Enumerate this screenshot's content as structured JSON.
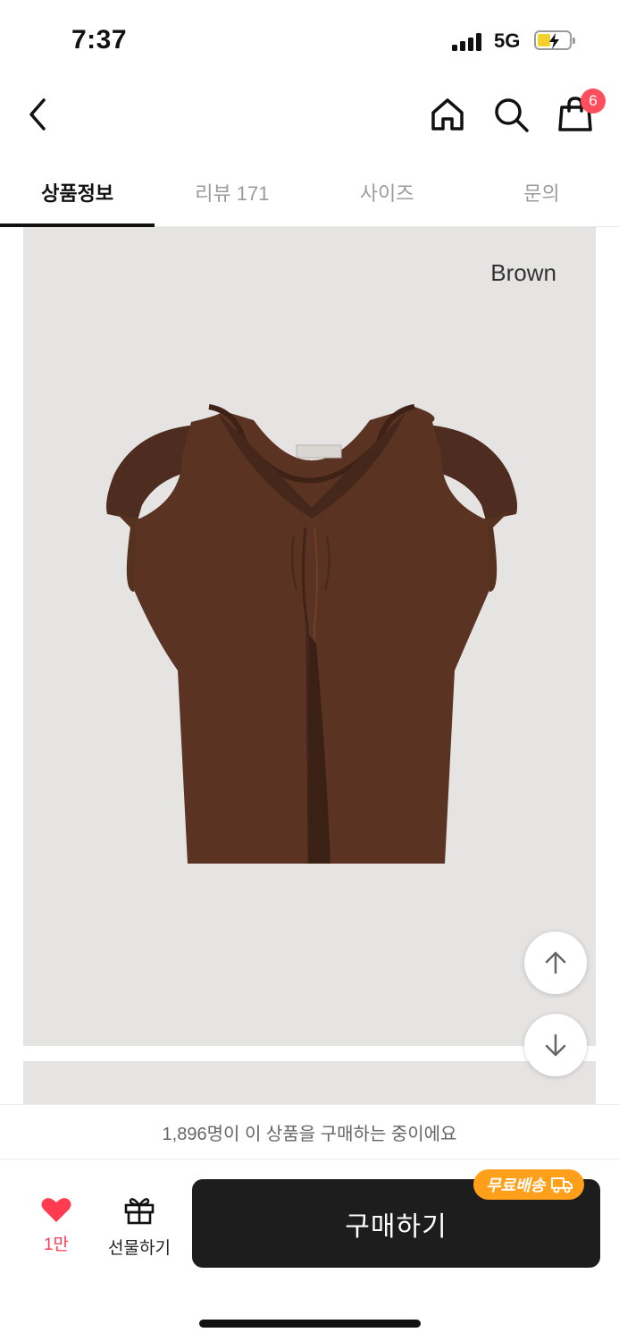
{
  "status_bar": {
    "time": "7:37",
    "network": "5G"
  },
  "nav": {
    "cart_count": "6"
  },
  "tabs": [
    {
      "label": "상품정보",
      "active": true
    },
    {
      "label": "리뷰 171",
      "active": false
    },
    {
      "label": "사이즈",
      "active": false
    },
    {
      "label": "문의",
      "active": false
    }
  ],
  "product": {
    "color_label": "Brown",
    "image_icon": "brown-shirt-image"
  },
  "purchase": {
    "notice": "1,896명이 이 상품을 구매하는 중이에요",
    "like_count": "1만",
    "gift_label": "선물하기",
    "buy_label": "구매하기",
    "free_shipping_label": "무료배송"
  },
  "colors": {
    "accent": "#ff3b4f",
    "badge": "#ff4f5e",
    "shipping": "#ff9f1a",
    "buy_button": "#1d1d1d",
    "image_bg": "#e5e4e3",
    "shirt": "#5a3323"
  }
}
